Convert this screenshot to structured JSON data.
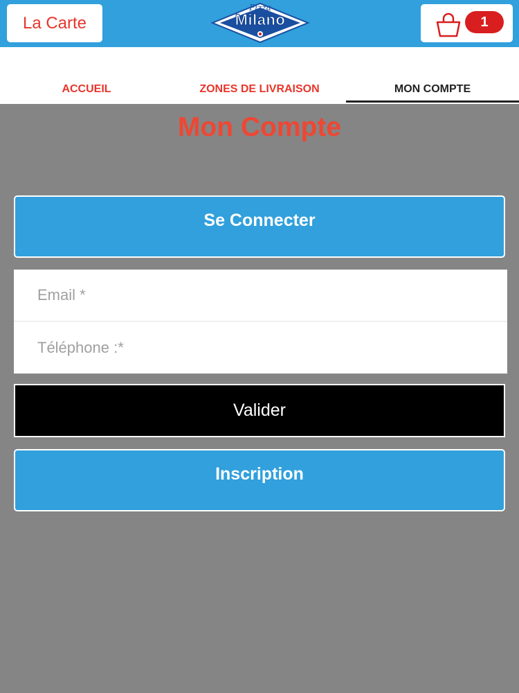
{
  "header": {
    "carte_label": "La Carte",
    "logo_text": "Milano",
    "logo_script": "Pizza",
    "cart_count": "1"
  },
  "tabs": [
    {
      "label": "ACCUEIL",
      "active": false
    },
    {
      "label": "ZONES DE LIVRAISON",
      "active": false
    },
    {
      "label": "MON COMPTE",
      "active": true
    }
  ],
  "page": {
    "title": "Mon Compte",
    "connect_label": "Se Connecter",
    "email_placeholder": "Email *",
    "phone_placeholder": "Téléphone :*",
    "valider_label": "Valider",
    "inscription_label": "Inscription"
  },
  "colors": {
    "header_blue": "#31a0dc",
    "accent_red": "#e8352b",
    "title_red": "#ee4733",
    "page_gray": "#858585"
  }
}
